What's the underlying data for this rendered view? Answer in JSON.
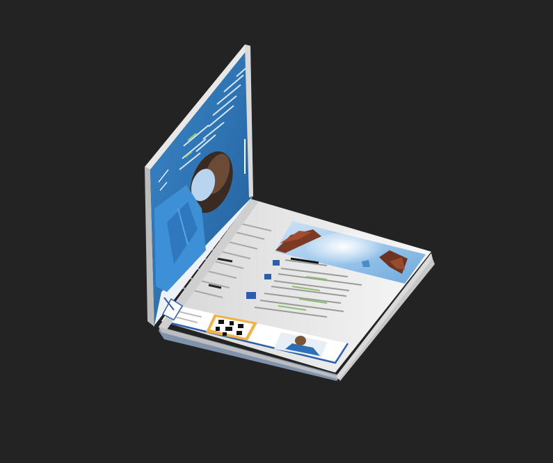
{
  "scene": {
    "background": "#232323",
    "object": "open-book-3d-model",
    "left_page": {
      "background_color": "#2f74b5",
      "figure": "person-with-face-mask"
    },
    "right_page": {
      "background_color": "#f4f4f4",
      "accent_color": "#2a5faa",
      "photo": "sky-with-tree-branches",
      "qr_code": "qr-code",
      "thumbnail": "person-portrait"
    }
  }
}
